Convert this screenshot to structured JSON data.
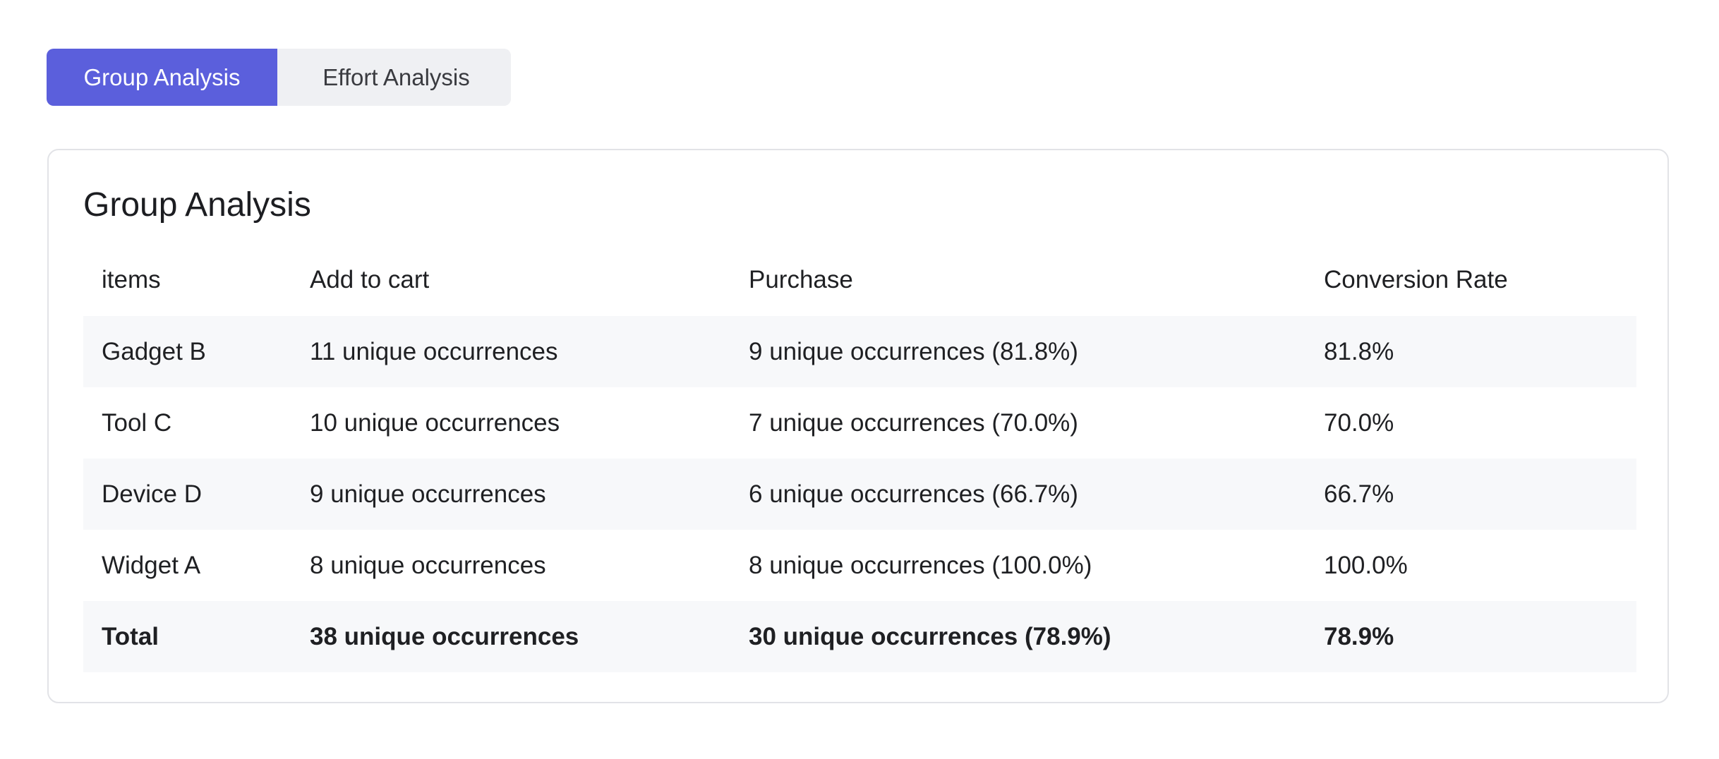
{
  "tabs": [
    {
      "label": "Group Analysis",
      "active": true
    },
    {
      "label": "Effort Analysis",
      "active": false
    }
  ],
  "card": {
    "title": "Group Analysis"
  },
  "table": {
    "columns": [
      "items",
      "Add to cart",
      "Purchase",
      "Conversion Rate"
    ],
    "rows": [
      [
        "Gadget B",
        "11 unique occurrences",
        "9 unique occurrences (81.8%)",
        "81.8%"
      ],
      [
        "Tool C",
        "10 unique occurrences",
        "7 unique occurrences (70.0%)",
        "70.0%"
      ],
      [
        "Device D",
        "9 unique occurrences",
        "6 unique occurrences (66.7%)",
        "66.7%"
      ],
      [
        "Widget A",
        "8 unique occurrences",
        "8 unique occurrences (100.0%)",
        "100.0%"
      ]
    ],
    "total": [
      "Total",
      "38 unique occurrences",
      "30 unique occurrences (78.9%)",
      "78.9%"
    ]
  },
  "colors": {
    "accent": "#5b5fdc",
    "tab_inactive_bg": "#eff0f3",
    "row_shade": "#f7f8fa",
    "card_border": "#e2e3e7"
  }
}
